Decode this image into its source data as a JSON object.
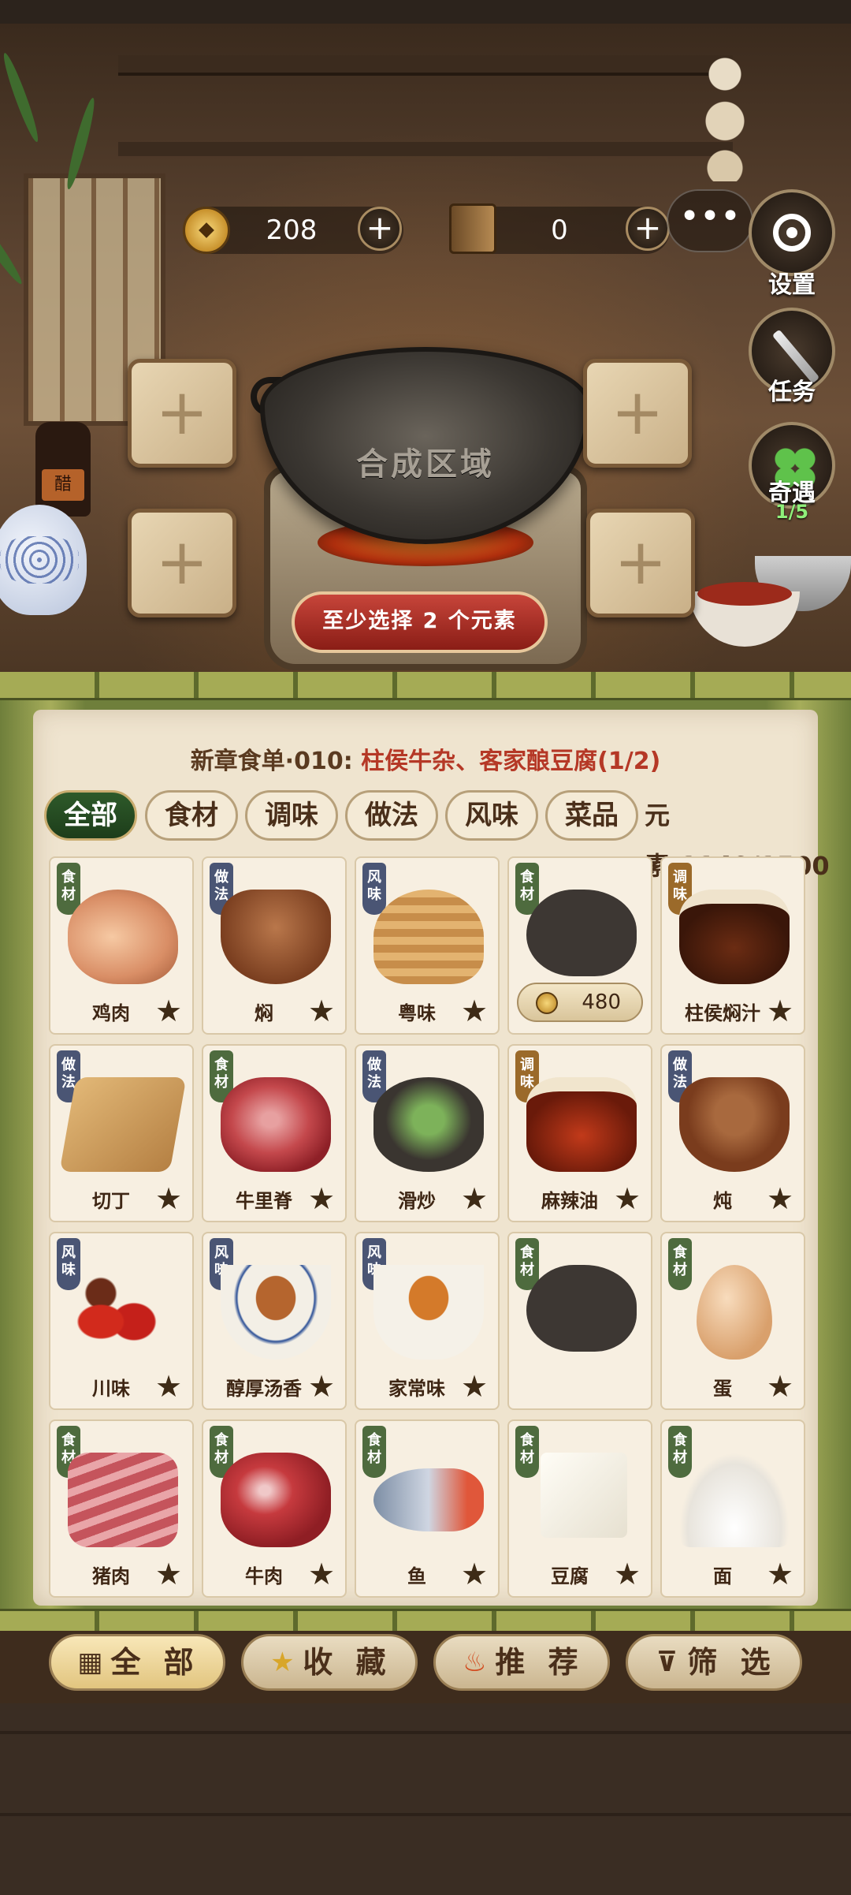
{
  "resources": {
    "coins": "208",
    "books": "0",
    "plus": "+",
    "more": "•••"
  },
  "side_buttons": {
    "settings": "设置",
    "tasks": "任务",
    "encounter": "奇遇",
    "encounter_progress": "1/5"
  },
  "wok": {
    "label": "合成区域"
  },
  "slots": {
    "plus": "+"
  },
  "hint": "至少选择 2 个元素",
  "chapter": {
    "prefix": "新章食单·010: ",
    "dishes": "柱侯牛杂、客家酿豆腐(1/2)"
  },
  "tabs": [
    "全部",
    "食材",
    "调味",
    "做法",
    "风味",
    "菜品"
  ],
  "elements_count": "元素:1149/1500",
  "cards": [
    {
      "tag": "食材",
      "name": "鸡肉",
      "star": "★"
    },
    {
      "tag": "做法",
      "name": "焖",
      "star": "★"
    },
    {
      "tag": "风味",
      "name": "粤味",
      "star": "★"
    },
    {
      "tag": "食材",
      "name": "",
      "price": "480"
    },
    {
      "tag": "调味",
      "name": "柱侯焖汁",
      "star": "★"
    },
    {
      "tag": "做法",
      "name": "切丁",
      "star": "★"
    },
    {
      "tag": "食材",
      "name": "牛里脊",
      "star": "★"
    },
    {
      "tag": "做法",
      "name": "滑炒",
      "star": "★"
    },
    {
      "tag": "调味",
      "name": "麻辣油",
      "star": "★"
    },
    {
      "tag": "做法",
      "name": "炖",
      "star": "★"
    },
    {
      "tag": "风味",
      "name": "川味",
      "star": "★"
    },
    {
      "tag": "风味",
      "name": "醇厚汤香",
      "star": "★"
    },
    {
      "tag": "风味",
      "name": "家常味",
      "star": "★"
    },
    {
      "tag": "食材",
      "name": ""
    },
    {
      "tag": "食材",
      "name": "蛋",
      "star": "★"
    },
    {
      "tag": "食材",
      "name": "猪肉",
      "star": "★"
    },
    {
      "tag": "食材",
      "name": "牛肉",
      "star": "★"
    },
    {
      "tag": "食材",
      "name": "鱼",
      "star": "★"
    },
    {
      "tag": "食材",
      "name": "豆腐",
      "star": "★"
    },
    {
      "tag": "食材",
      "name": "面",
      "star": "★"
    }
  ],
  "nav": {
    "all": "全 部",
    "favorites": "收 藏",
    "recommended": "推 荐",
    "filter": "筛 选"
  }
}
